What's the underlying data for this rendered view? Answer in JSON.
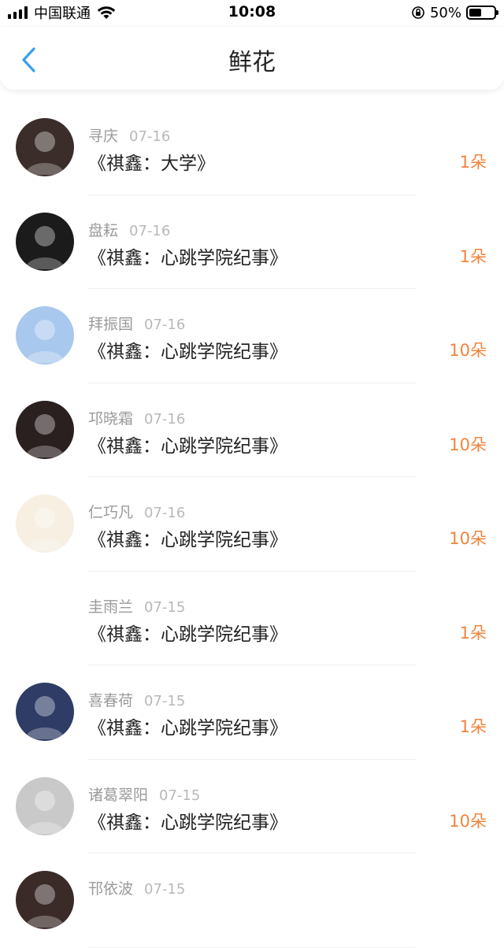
{
  "status": {
    "carrier": "中国联通",
    "time": "10:08",
    "battery": "50%",
    "battery_level": 0.5
  },
  "nav": {
    "back_icon": "chevron-left-icon",
    "title": "鲜花",
    "accent": "#3aa0e6"
  },
  "list": [
    {
      "name": "寻庆",
      "date": "07-16",
      "book": "《祺鑫：大学》",
      "count": "1朵",
      "avatar_bg": "#3b2e2a"
    },
    {
      "name": "盘耘",
      "date": "07-16",
      "book": "《祺鑫：心跳学院纪事》",
      "count": "1朵",
      "avatar_bg": "#1b1b1b"
    },
    {
      "name": "拜振国",
      "date": "07-16",
      "book": "《祺鑫：心跳学院纪事》",
      "count": "10朵",
      "avatar_bg": "#a9c8ee"
    },
    {
      "name": "邛晓霜",
      "date": "07-16",
      "book": "《祺鑫：心跳学院纪事》",
      "count": "10朵",
      "avatar_bg": "#2b2020"
    },
    {
      "name": "仁巧凡",
      "date": "07-16",
      "book": "《祺鑫：心跳学院纪事》",
      "count": "10朵",
      "avatar_bg": "#f6efe2"
    },
    {
      "name": "圭雨兰",
      "date": "07-15",
      "book": "《祺鑫：心跳学院纪事》",
      "count": "1朵",
      "avatar_bg": "#ffffff"
    },
    {
      "name": "喜春荷",
      "date": "07-15",
      "book": "《祺鑫：心跳学院纪事》",
      "count": "1朵",
      "avatar_bg": "#2e3c66"
    },
    {
      "name": "诸葛翠阳",
      "date": "07-15",
      "book": "《祺鑫：心跳学院纪事》",
      "count": "10朵",
      "avatar_bg": "#c9c9c9"
    },
    {
      "name": "邗依波",
      "date": "07-15",
      "book": "",
      "count": "",
      "avatar_bg": "#3a2a28"
    }
  ],
  "colors": {
    "count": "#f0843c",
    "name": "#9a9a9a",
    "book": "#222222"
  }
}
